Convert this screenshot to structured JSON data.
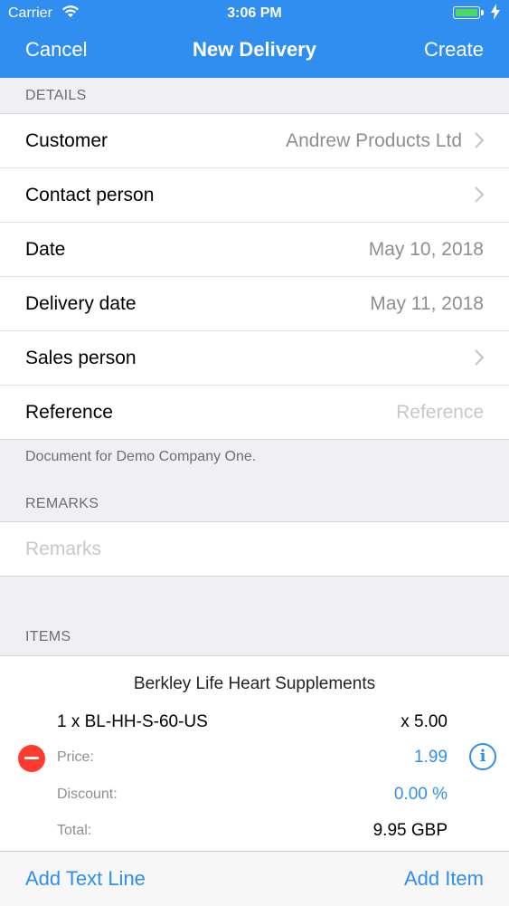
{
  "status_bar": {
    "carrier": "Carrier",
    "time": "3:06 PM"
  },
  "nav": {
    "cancel": "Cancel",
    "title": "New Delivery",
    "create": "Create"
  },
  "details": {
    "header": "DETAILS",
    "rows": [
      {
        "label": "Customer",
        "value": "Andrew Products Ltd"
      },
      {
        "label": "Contact person",
        "value": ""
      },
      {
        "label": "Date",
        "value": "May 10, 2018"
      },
      {
        "label": "Delivery date",
        "value": "May 11, 2018"
      },
      {
        "label": "Sales person",
        "value": ""
      },
      {
        "label": "Reference",
        "placeholder": "Reference"
      }
    ],
    "footer": "Document for Demo Company One."
  },
  "remarks": {
    "header": "REMARKS",
    "placeholder": "Remarks"
  },
  "items": {
    "header": "ITEMS",
    "list": [
      {
        "name": "Berkley Life Heart Supplements",
        "qty_line": "1 x BL-HH-S-60-US",
        "multiplier": "x 5.00",
        "price_label": "Price:",
        "price": "1.99",
        "discount_label": "Discount:",
        "discount": "0.00 %",
        "total_label": "Total:",
        "total": "9.95 GBP"
      }
    ]
  },
  "toolbar": {
    "add_text_line": "Add Text Line",
    "add_item": "Add Item"
  },
  "colors": {
    "accent": "#2f8ef0",
    "delete": "#ff3b30",
    "background": "#efeff4"
  }
}
